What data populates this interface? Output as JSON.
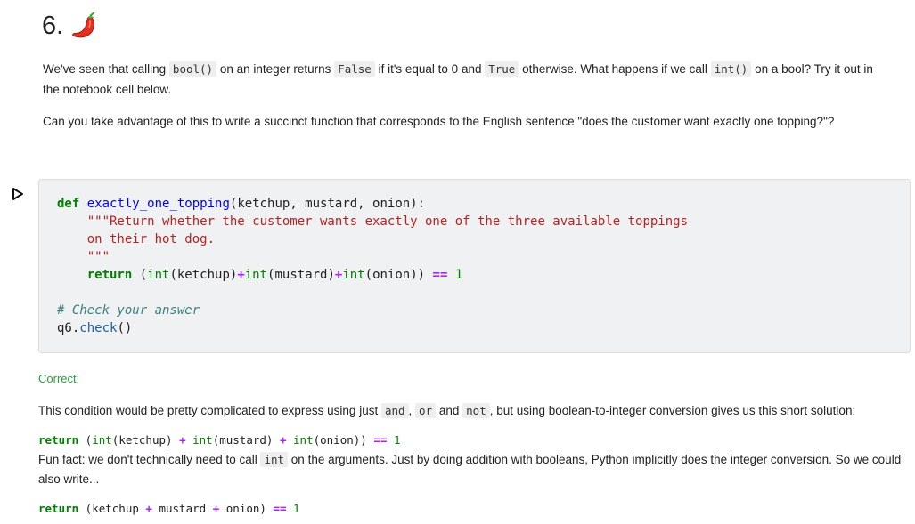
{
  "heading": {
    "number": "6.",
    "emoji_icon": "hot-pepper-icon"
  },
  "question": {
    "p1_a": "We've seen that calling ",
    "p1_code1": "bool()",
    "p1_b": " on an integer returns ",
    "p1_code2": "False",
    "p1_c": " if it's equal to 0 and ",
    "p1_code3": "True",
    "p1_d": " otherwise. What happens if we call ",
    "p1_code4": "int()",
    "p1_e": " on a bool? Try it out in the notebook cell below.",
    "p2": "Can you take advantage of this to write a succinct function that corresponds to the English sentence \"does the customer want exactly one topping?\"?"
  },
  "cell": {
    "run_icon": "run-triangle-icon",
    "l1_def": "def",
    "l1_name": "exactly_one_topping",
    "l1_args": "(ketchup, mustard, onion):",
    "l2": "    \"\"\"Return whether the customer wants exactly one of the three available toppings",
    "l3": "    on their hot dog.",
    "l4": "    \"\"\"",
    "l5_ret": "return",
    "l5_open": " (",
    "l5_int1": "int",
    "l5_a1": "(ketchup)",
    "l5_plus1": "+",
    "l5_int2": "int",
    "l5_a2": "(mustard)",
    "l5_plus2": "+",
    "l5_int3": "int",
    "l5_a3": "(onion))",
    "l5_eq": "==",
    "l5_one": "1",
    "l7": "# Check your answer",
    "l8_obj": "q6.",
    "l8_meth": "check",
    "l8_par": "()"
  },
  "result": {
    "status": "Correct:",
    "t1_a": "This condition would be pretty complicated to express using just ",
    "t1_and": "and",
    "t1_b": ", ",
    "t1_or": "or",
    "t1_c": " and ",
    "t1_not": "not",
    "t1_d": ", but using boolean-to-integer conversion gives us this short solution:",
    "s1_ret": "return",
    "s1_open": " (",
    "s1_int1": "int",
    "s1_a1": "(ketchup) ",
    "s1_p1": "+",
    "s1_int2": "int",
    "s1_a2": "(mustard) ",
    "s1_p2": "+",
    "s1_int3": "int",
    "s1_a3": "(onion)) ",
    "s1_eq": "==",
    "s1_one": "1",
    "t2_a": "Fun fact: we don't technically need to call ",
    "t2_int": "int",
    "t2_b": " on the arguments. Just by doing addition with booleans, Python implicitly does the integer conversion. So we could also write...",
    "s2_ret": "return",
    "s2_a": " (ketchup ",
    "s2_p1": "+",
    "s2_b": " mustard ",
    "s2_p2": "+",
    "s2_c": " onion) ",
    "s2_eq": "==",
    "s2_one": "1"
  }
}
